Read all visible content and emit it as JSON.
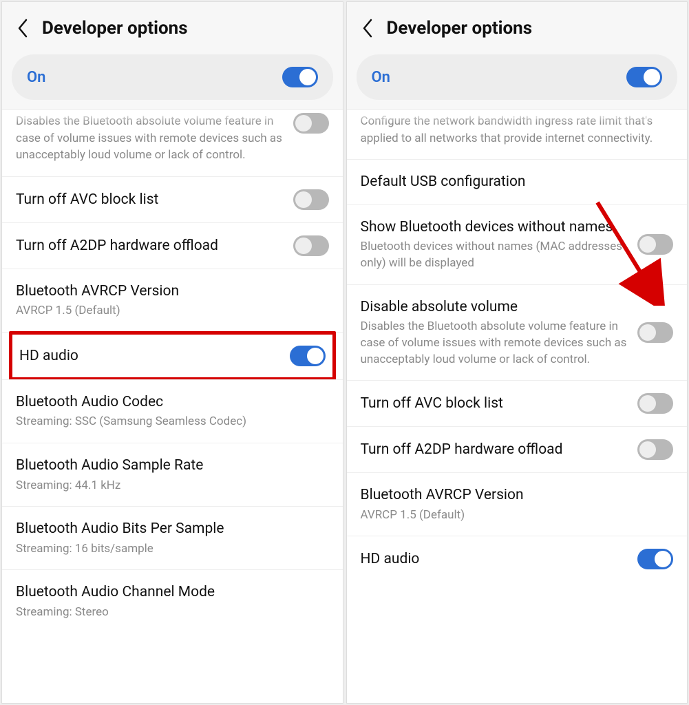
{
  "left": {
    "header": {
      "title": "Developer options"
    },
    "master_toggle": {
      "label": "On",
      "state": "on"
    },
    "partial_top": {
      "text": "Disables the Bluetooth absolute volume feature in case of volume issues with remote devices such as unacceptably loud volume or lack of control.",
      "toggle": "off"
    },
    "items": [
      {
        "primary": "Turn off AVC block list",
        "toggle": "off"
      },
      {
        "primary": "Turn off A2DP hardware offload",
        "toggle": "off"
      },
      {
        "primary": "Bluetooth AVRCP Version",
        "secondary": "AVRCP 1.5 (Default)"
      },
      {
        "primary": "HD audio",
        "toggle": "on",
        "highlight": true
      },
      {
        "primary": "Bluetooth Audio Codec",
        "secondary": "Streaming: SSC (Samsung Seamless Codec)"
      },
      {
        "primary": "Bluetooth Audio Sample Rate",
        "secondary": "Streaming: 44.1 kHz"
      },
      {
        "primary": "Bluetooth Audio Bits Per Sample",
        "secondary": "Streaming: 16 bits/sample"
      },
      {
        "primary": "Bluetooth Audio Channel Mode",
        "secondary": "Streaming: Stereo"
      }
    ]
  },
  "right": {
    "header": {
      "title": "Developer options"
    },
    "master_toggle": {
      "label": "On",
      "state": "on"
    },
    "partial_top": {
      "text": "Configure the network bandwidth ingress rate limit that's applied to all networks that provide internet connectivity."
    },
    "items": [
      {
        "primary": "Default USB configuration"
      },
      {
        "primary": "Show Bluetooth devices without names",
        "secondary": "Bluetooth devices without names (MAC addresses only) will be displayed",
        "toggle": "off"
      },
      {
        "primary": "Disable absolute volume",
        "secondary": "Disables the Bluetooth absolute volume feature in case of volume issues with remote devices such as unacceptably loud volume or lack of control.",
        "toggle": "off",
        "arrow": true
      },
      {
        "primary": "Turn off AVC block list",
        "toggle": "off"
      },
      {
        "primary": "Turn off A2DP hardware offload",
        "toggle": "off"
      },
      {
        "primary": "Bluetooth AVRCP Version",
        "secondary": "AVRCP 1.5 (Default)"
      },
      {
        "primary": "HD audio",
        "toggle": "on"
      }
    ]
  }
}
